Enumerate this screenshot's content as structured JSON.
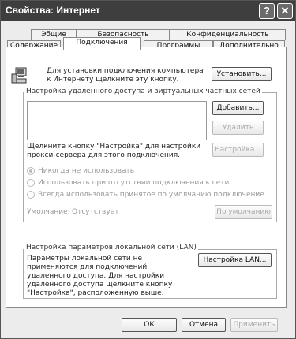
{
  "window": {
    "title": "Свойства: Интернет",
    "help": "?",
    "close": "✕"
  },
  "tabs": {
    "row1": [
      "Эбщие",
      "Безопасность",
      "Конфиденциальность"
    ],
    "row2": [
      "Содержание",
      "Подключения",
      "Программы",
      "Дополнительно"
    ]
  },
  "setup": {
    "text": "Для установки подключения компьютера к Интернету щелкните эту кнопку.",
    "button": "Установить..."
  },
  "dialup": {
    "legend": "Настройка удаленного доступа и виртуальных частных сетей",
    "add": "Добавить...",
    "remove": "Удалить",
    "settings": "Настройка...",
    "proxy_text": "Щелкните кнопку \"Настройка\" для настройки прокси-сервера для этого подключения.",
    "radios": [
      "Никогда не использовать",
      "Использовать при отсутствии подключения к сети",
      "Всегда использовать принятое по умолчанию подключение"
    ],
    "default_label": "Умолчание:",
    "default_value": "Отсутствует",
    "default_button": "По умолчанию"
  },
  "lan": {
    "legend": "Настройка параметров локальной сети (LAN)",
    "text": "Параметры локальной сети не применяются для подключений удаленного доступа. Для настройки удаленного доступа щелкните кнопку \"Настройка\", расположенную выше.",
    "button": "Настройка LAN..."
  },
  "footer": {
    "ok": "ОК",
    "cancel": "Отмена",
    "apply": "Применить"
  },
  "icons": {
    "computer": "computer-icon",
    "help": "help-icon",
    "close": "close-icon"
  }
}
